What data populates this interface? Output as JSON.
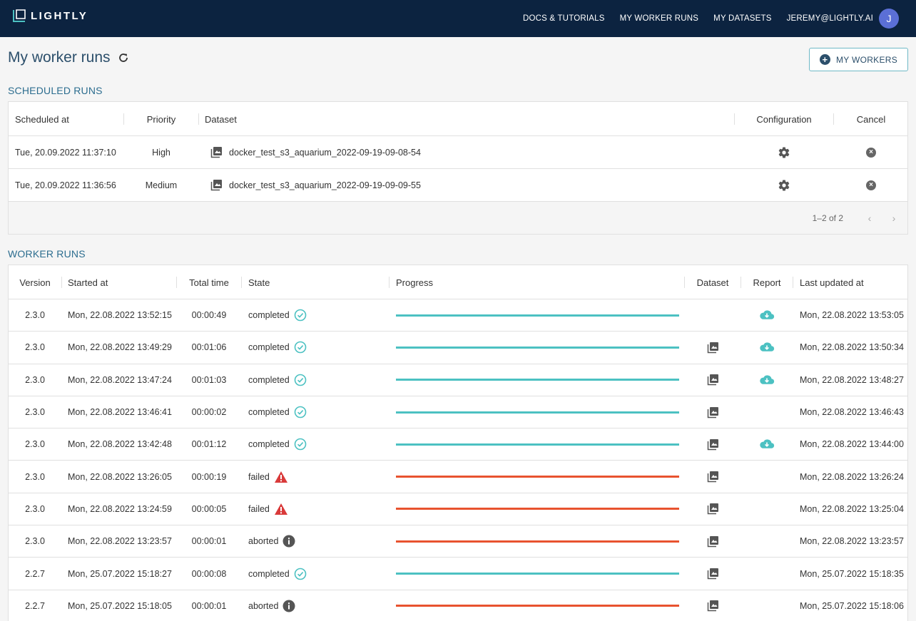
{
  "app": {
    "logo_text": "LIGHTLY"
  },
  "nav": {
    "docs": "DOCS & TUTORIALS",
    "worker_runs": "MY WORKER RUNS",
    "datasets": "MY DATASETS",
    "user": "JEREMY@LIGHTLY.AI",
    "avatar_letter": "J"
  },
  "page": {
    "title": "My worker runs",
    "workers_button": "MY WORKERS"
  },
  "scheduled": {
    "section_title": "SCHEDULED RUNS",
    "headers": {
      "scheduled_at": "Scheduled at",
      "priority": "Priority",
      "dataset": "Dataset",
      "configuration": "Configuration",
      "cancel": "Cancel"
    },
    "rows": [
      {
        "scheduled_at": "Tue, 20.09.2022 11:37:10",
        "priority": "High",
        "dataset": "docker_test_s3_aquarium_2022-09-19-09-08-54"
      },
      {
        "scheduled_at": "Tue, 20.09.2022 11:36:56",
        "priority": "Medium",
        "dataset": "docker_test_s3_aquarium_2022-09-19-09-09-55"
      }
    ],
    "pagination": "1–2 of 2"
  },
  "worker_runs": {
    "section_title": "WORKER RUNS",
    "headers": {
      "version": "Version",
      "started_at": "Started at",
      "total_time": "Total time",
      "state": "State",
      "progress": "Progress",
      "dataset": "Dataset",
      "report": "Report",
      "last_updated": "Last updated at"
    },
    "rows": [
      {
        "version": "2.3.0",
        "started_at": "Mon, 22.08.2022 13:52:15",
        "total_time": "00:00:49",
        "state": "completed",
        "progress": 1.0,
        "has_dataset": false,
        "has_report": true,
        "last_updated": "Mon, 22.08.2022 13:53:05"
      },
      {
        "version": "2.3.0",
        "started_at": "Mon, 22.08.2022 13:49:29",
        "total_time": "00:01:06",
        "state": "completed",
        "progress": 1.0,
        "has_dataset": true,
        "has_report": true,
        "last_updated": "Mon, 22.08.2022 13:50:34"
      },
      {
        "version": "2.3.0",
        "started_at": "Mon, 22.08.2022 13:47:24",
        "total_time": "00:01:03",
        "state": "completed",
        "progress": 1.0,
        "has_dataset": true,
        "has_report": true,
        "last_updated": "Mon, 22.08.2022 13:48:27"
      },
      {
        "version": "2.3.0",
        "started_at": "Mon, 22.08.2022 13:46:41",
        "total_time": "00:00:02",
        "state": "completed",
        "progress": 1.0,
        "has_dataset": true,
        "has_report": false,
        "last_updated": "Mon, 22.08.2022 13:46:43"
      },
      {
        "version": "2.3.0",
        "started_at": "Mon, 22.08.2022 13:42:48",
        "total_time": "00:01:12",
        "state": "completed",
        "progress": 1.0,
        "has_dataset": true,
        "has_report": true,
        "last_updated": "Mon, 22.08.2022 13:44:00"
      },
      {
        "version": "2.3.0",
        "started_at": "Mon, 22.08.2022 13:26:05",
        "total_time": "00:00:19",
        "state": "failed",
        "progress": 1.0,
        "has_dataset": true,
        "has_report": false,
        "last_updated": "Mon, 22.08.2022 13:26:24"
      },
      {
        "version": "2.3.0",
        "started_at": "Mon, 22.08.2022 13:24:59",
        "total_time": "00:00:05",
        "state": "failed",
        "progress": 1.0,
        "has_dataset": true,
        "has_report": false,
        "last_updated": "Mon, 22.08.2022 13:25:04"
      },
      {
        "version": "2.3.0",
        "started_at": "Mon, 22.08.2022 13:23:57",
        "total_time": "00:00:01",
        "state": "aborted",
        "progress": 1.0,
        "has_dataset": true,
        "has_report": false,
        "last_updated": "Mon, 22.08.2022 13:23:57"
      },
      {
        "version": "2.2.7",
        "started_at": "Mon, 25.07.2022 15:18:27",
        "total_time": "00:00:08",
        "state": "completed",
        "progress": 1.0,
        "has_dataset": true,
        "has_report": false,
        "last_updated": "Mon, 25.07.2022 15:18:35"
      },
      {
        "version": "2.2.7",
        "started_at": "Mon, 25.07.2022 15:18:05",
        "total_time": "00:00:01",
        "state": "aborted",
        "progress": 1.0,
        "has_dataset": true,
        "has_report": false,
        "last_updated": "Mon, 25.07.2022 15:18:06"
      }
    ]
  },
  "colors": {
    "topbar": "#0c2340",
    "success": "#4cc1c2",
    "error": "#e8532f",
    "failed_icon": "#d93a3a",
    "info_icon": "#555555"
  },
  "icons": {
    "logo": "lightly-logo-icon",
    "refresh": "refresh-icon",
    "add": "plus-circle-icon",
    "config": "gear-icon",
    "cancel": "cancel-circle-icon",
    "dataset": "image-gallery-icon",
    "report": "cloud-download-icon",
    "completed": "check-circle-icon",
    "failed": "warning-triangle-icon",
    "aborted": "info-circle-icon",
    "prev": "chevron-left-icon",
    "next": "chevron-right-icon"
  }
}
